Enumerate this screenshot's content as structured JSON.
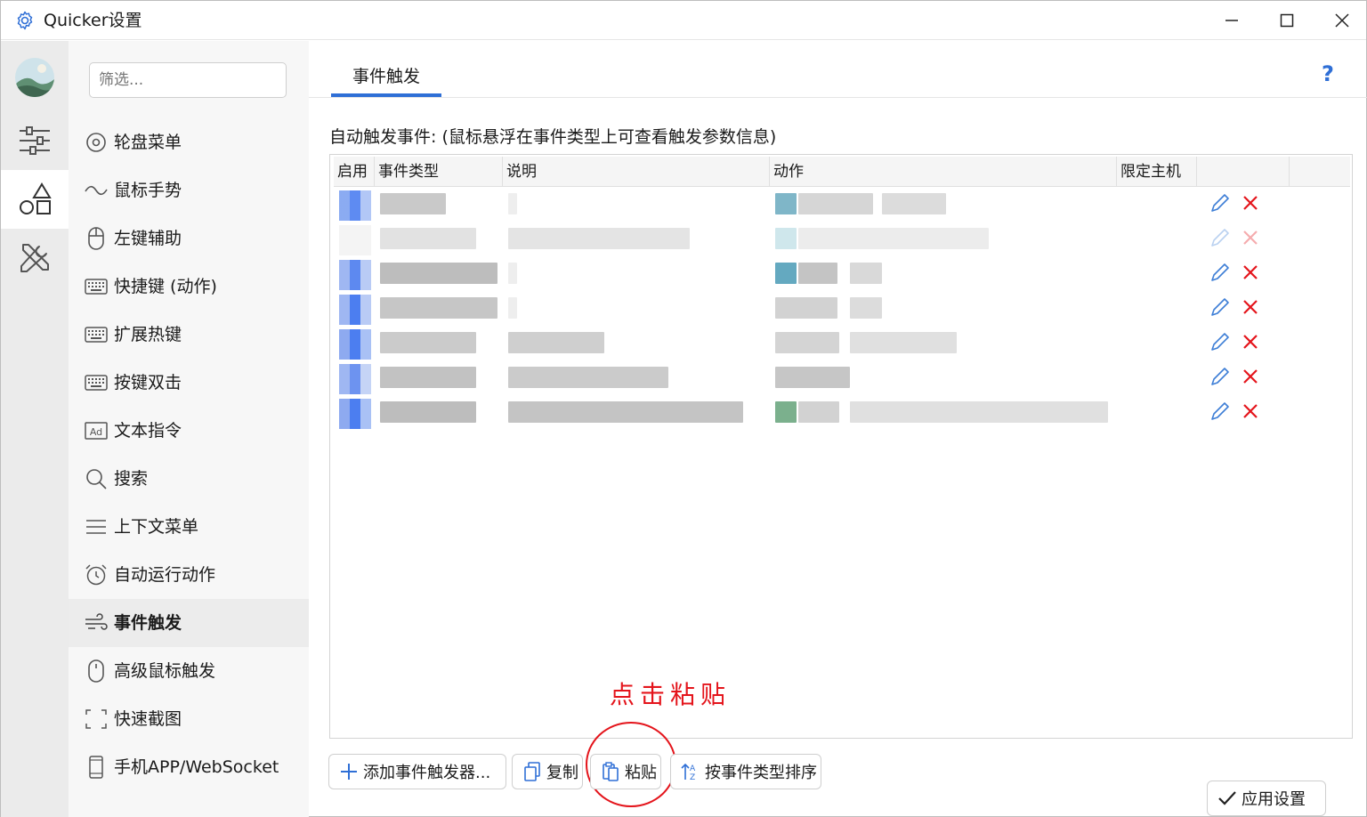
{
  "window": {
    "title": "Quicker设置"
  },
  "filter": {
    "placeholder": "筛选..."
  },
  "nav": {
    "items": [
      {
        "label": "轮盘菜单",
        "icon": "wheel-icon"
      },
      {
        "label": "鼠标手势",
        "icon": "wave-icon"
      },
      {
        "label": "左键辅助",
        "icon": "mouse-icon"
      },
      {
        "label": "快捷键 (动作)",
        "icon": "keyboard-icon"
      },
      {
        "label": "扩展热键",
        "icon": "keyboard-icon"
      },
      {
        "label": "按键双击",
        "icon": "keyboard-icon"
      },
      {
        "label": "文本指令",
        "icon": "text-ad-icon"
      },
      {
        "label": "搜索",
        "icon": "search-icon"
      },
      {
        "label": "上下文菜单",
        "icon": "menu-lines-icon"
      },
      {
        "label": "自动运行动作",
        "icon": "alarm-clock-icon"
      },
      {
        "label": "事件触发",
        "icon": "wind-icon",
        "active": true
      },
      {
        "label": "高级鼠标触发",
        "icon": "mouse-icon"
      },
      {
        "label": "快速截图",
        "icon": "screenshot-icon"
      },
      {
        "label": "手机APP/WebSocket",
        "icon": "phone-icon"
      }
    ]
  },
  "main": {
    "tab": "事件触发",
    "help": "?",
    "section_label": "自动触发事件:  (鼠标悬浮在事件类型上可查看触发参数信息)",
    "columns": [
      "启用",
      "事件类型",
      "说明",
      "动作",
      "限定主机"
    ],
    "row_count": 7
  },
  "buttons": {
    "add": "添加事件触发器...",
    "copy": "复制",
    "paste": "粘贴",
    "sort": "按事件类型排序",
    "apply": "应用设置"
  },
  "annotation": {
    "text": "点击粘贴"
  },
  "colors": {
    "accent": "#2f6fd6",
    "danger": "#e4141b",
    "annotation": "#e4141b"
  }
}
